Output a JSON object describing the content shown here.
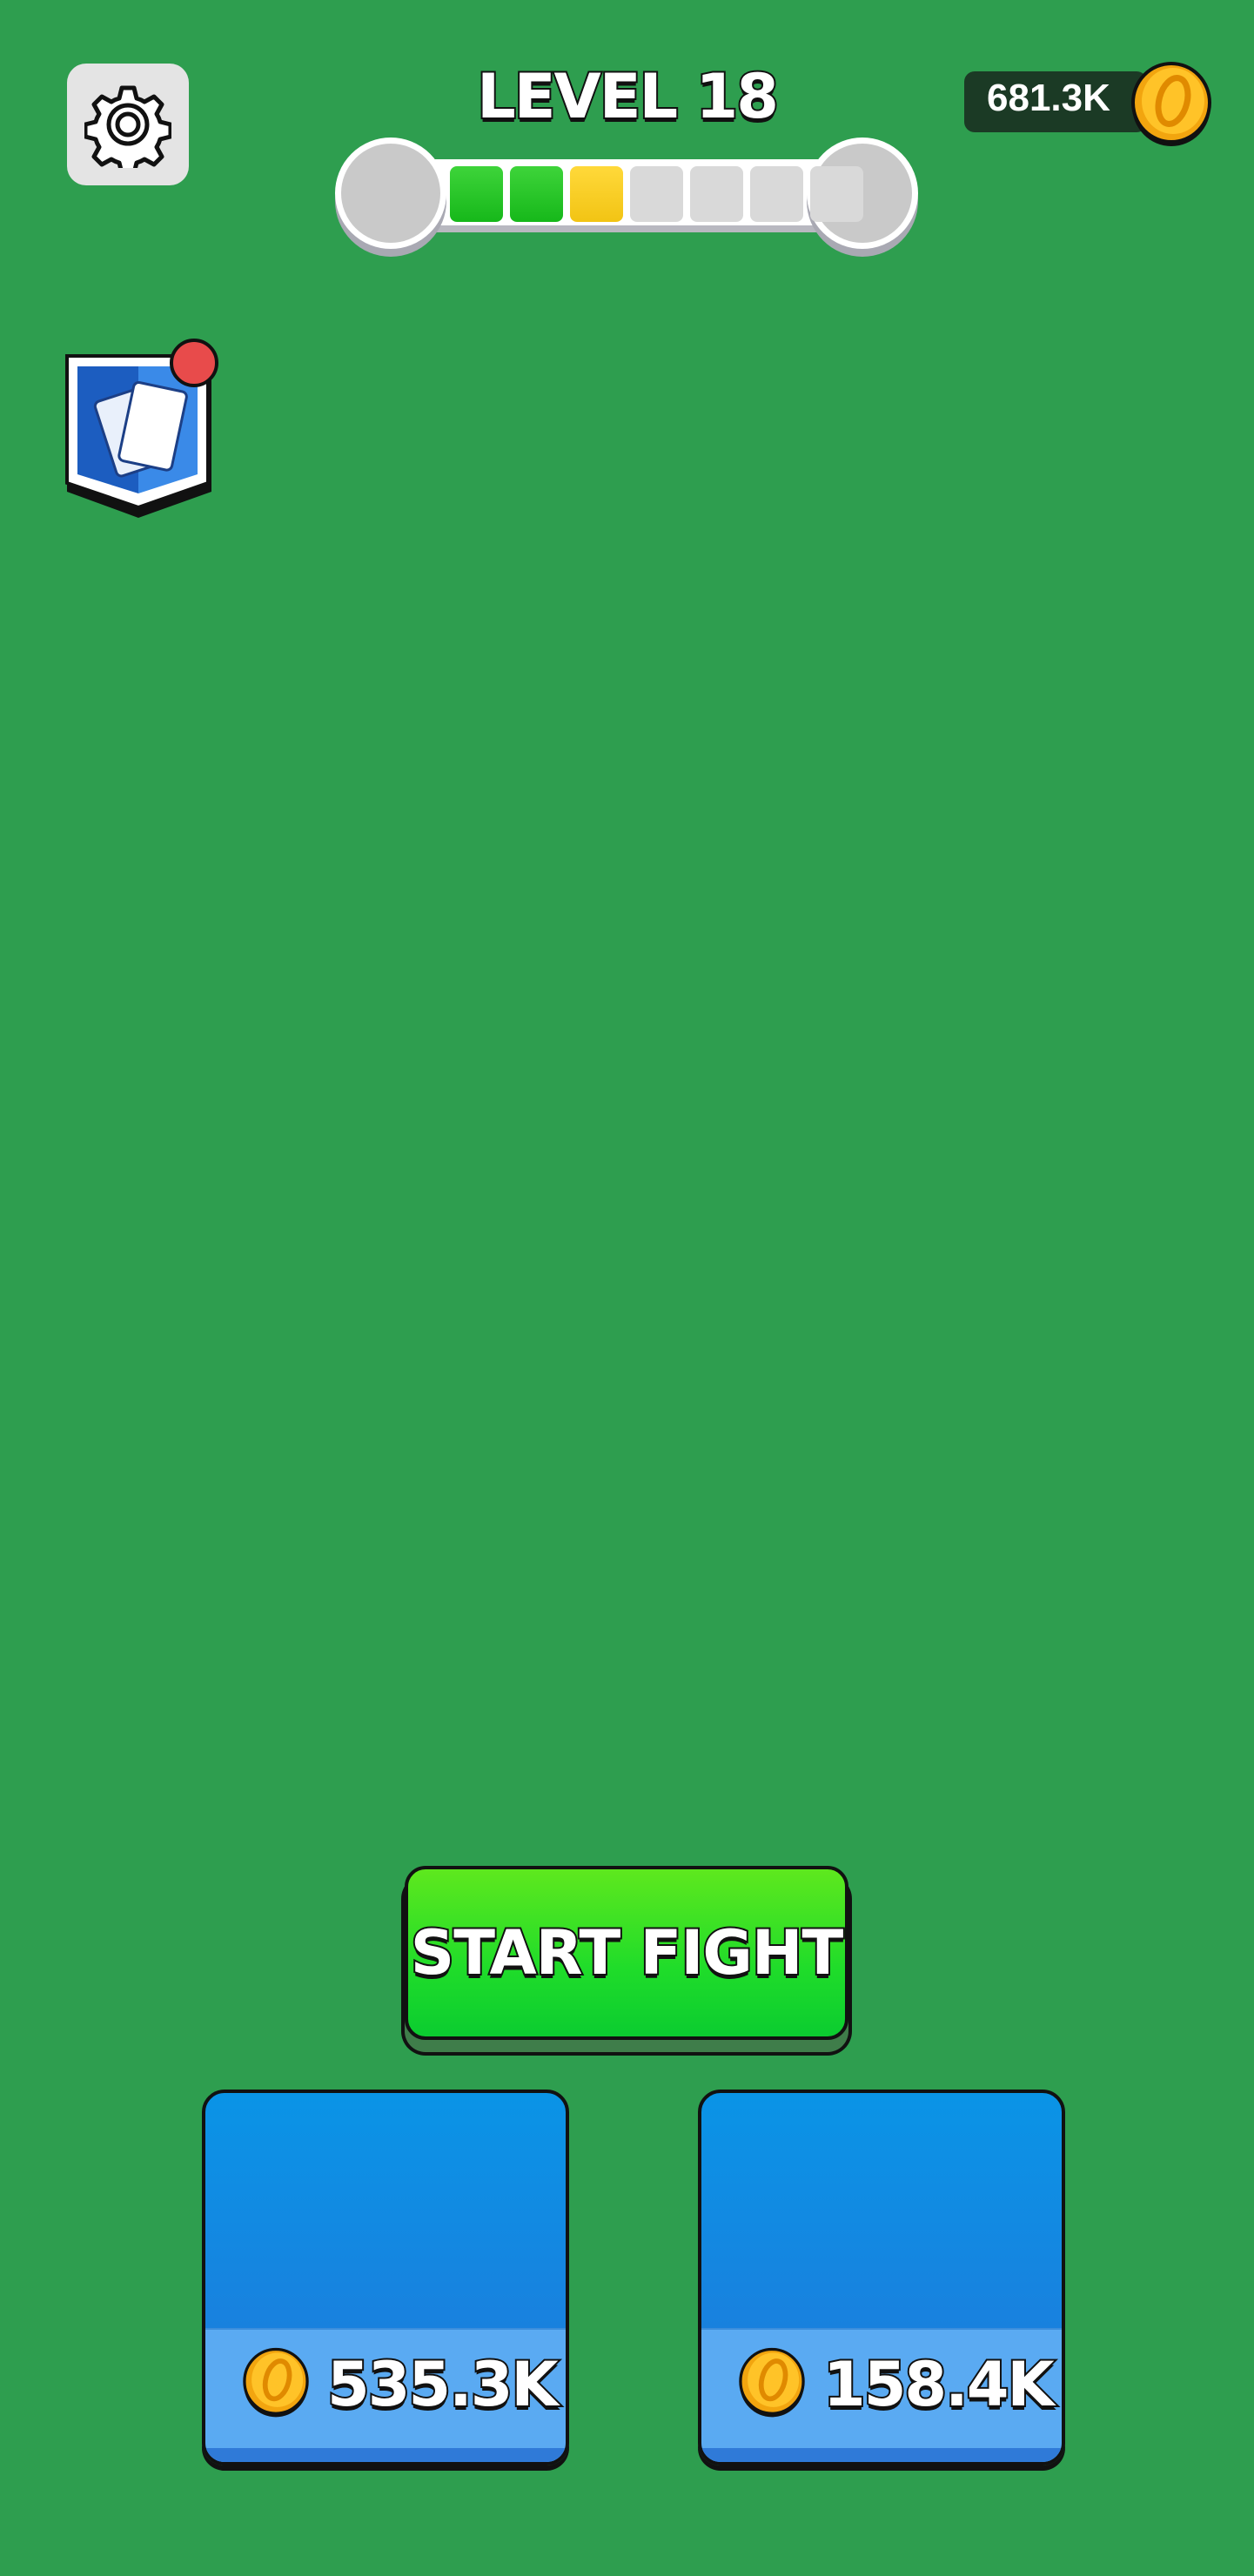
{
  "header": {
    "level_label": "LEVEL 18",
    "progress": {
      "total_segments": 7,
      "completed": 2,
      "current": 3
    },
    "coins": "681.3K"
  },
  "colors": {
    "background": "#2e9e4f",
    "segment_done": "#1fc82a",
    "segment_current": "#f6cb1c",
    "segment_empty": "#d9d9d9",
    "button_green": "#1fdc2a",
    "shop_blue": "#0a94e6",
    "notification_red": "#e84b4b"
  },
  "icons": [
    "gear-icon",
    "cards-icon",
    "coin-icon"
  ],
  "main": {
    "start_button": "START FIGHT"
  },
  "shop": [
    {
      "price": "535.3K"
    },
    {
      "price": "158.4K"
    }
  ]
}
